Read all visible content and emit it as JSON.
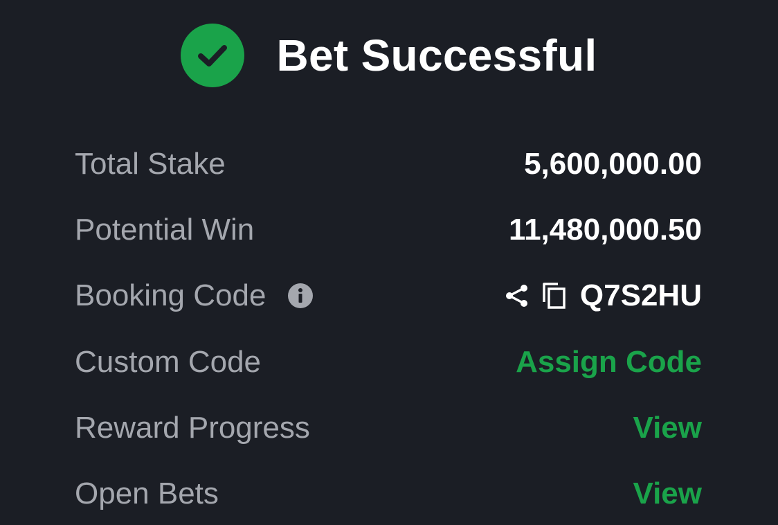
{
  "header": {
    "title": "Bet Successful",
    "icon": "check-circle-icon",
    "accent": "#1aa34a"
  },
  "rows": {
    "total_stake": {
      "label": "Total Stake",
      "value": "5,600,000.00"
    },
    "potential_win": {
      "label": "Potential Win",
      "value": "11,480,000.50"
    },
    "booking_code": {
      "label": "Booking Code",
      "value": "Q7S2HU",
      "icons": [
        "info-icon",
        "share-icon",
        "copy-icon"
      ]
    },
    "custom_code": {
      "label": "Custom Code",
      "action": "Assign Code"
    },
    "reward_progress": {
      "label": "Reward Progress",
      "action": "View"
    },
    "open_bets": {
      "label": "Open Bets",
      "action": "View"
    }
  },
  "colors": {
    "background": "#1b1e25",
    "label": "#a4a7ae",
    "value": "#ffffff",
    "link": "#1aa34a"
  }
}
